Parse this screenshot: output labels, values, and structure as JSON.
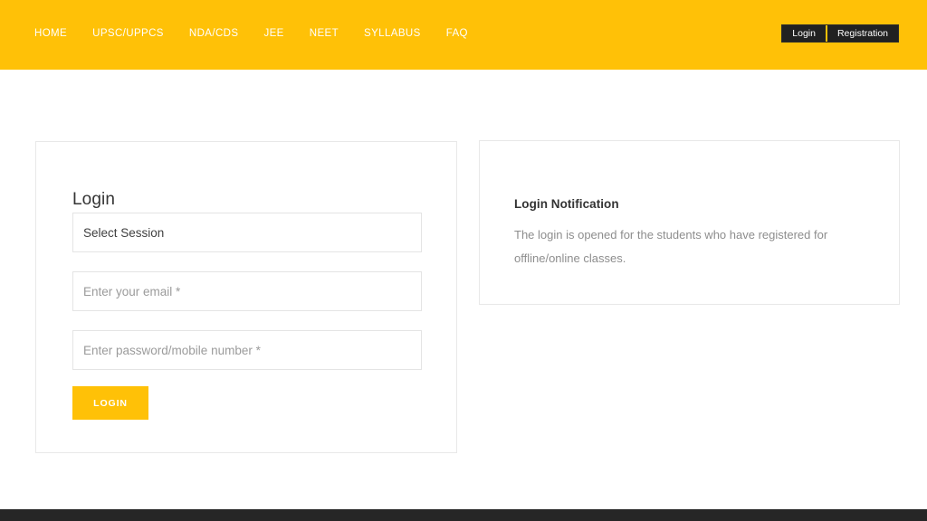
{
  "header": {
    "nav_items": [
      {
        "label": "HOME",
        "name": "nav-home"
      },
      {
        "label": "UPSC/UPPCS",
        "name": "nav-upsc-uppcs"
      },
      {
        "label": "NDA/CDS",
        "name": "nav-nda-cds"
      },
      {
        "label": "JEE",
        "name": "nav-jee"
      },
      {
        "label": "NEET",
        "name": "nav-neet"
      },
      {
        "label": "SYLLABUS",
        "name": "nav-syllabus"
      },
      {
        "label": "FAQ",
        "name": "nav-faq"
      }
    ],
    "auth": {
      "login_label": "Login",
      "registration_label": "Registration"
    },
    "background_color": "#ffc107",
    "text_color": "#ffffff"
  },
  "login_card": {
    "title": "Login",
    "session_select": {
      "selected": "Select Session",
      "options": [
        "Select Session"
      ],
      "icon": "chevron-down-icon"
    },
    "email": {
      "placeholder": "Enter your email *",
      "value": ""
    },
    "password": {
      "placeholder": "Enter password/mobile number *",
      "value": ""
    },
    "submit_label": "LOGIN",
    "submit_color": "#ffc107"
  },
  "notification_card": {
    "title": "Login Notification",
    "body": "The login is opened for the students who have registered for offline/online classes."
  },
  "footer": {
    "background_color": "#262626"
  }
}
